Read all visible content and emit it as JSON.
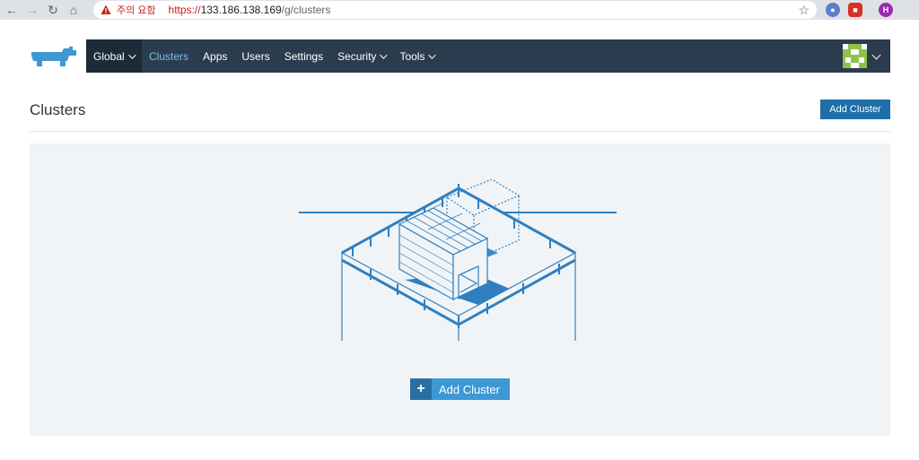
{
  "browser": {
    "warning_text": "주의 요함",
    "url_scheme": "https://",
    "url_host": "133.186.138.169",
    "url_path": "/g/clusters",
    "profile_initial": "H"
  },
  "nav": {
    "global_label": "Global",
    "items": [
      {
        "label": "Clusters",
        "current": true
      },
      {
        "label": "Apps"
      },
      {
        "label": "Users"
      },
      {
        "label": "Settings"
      },
      {
        "label": "Security",
        "dropdown": true
      },
      {
        "label": "Tools",
        "dropdown": true
      }
    ]
  },
  "page": {
    "title": "Clusters",
    "add_cluster_label": "Add Cluster",
    "empty_add_cluster_label": "Add Cluster"
  },
  "colors": {
    "navbar": "#2b3c4e",
    "accent": "#3d98d3",
    "button": "#1e6ea7"
  }
}
